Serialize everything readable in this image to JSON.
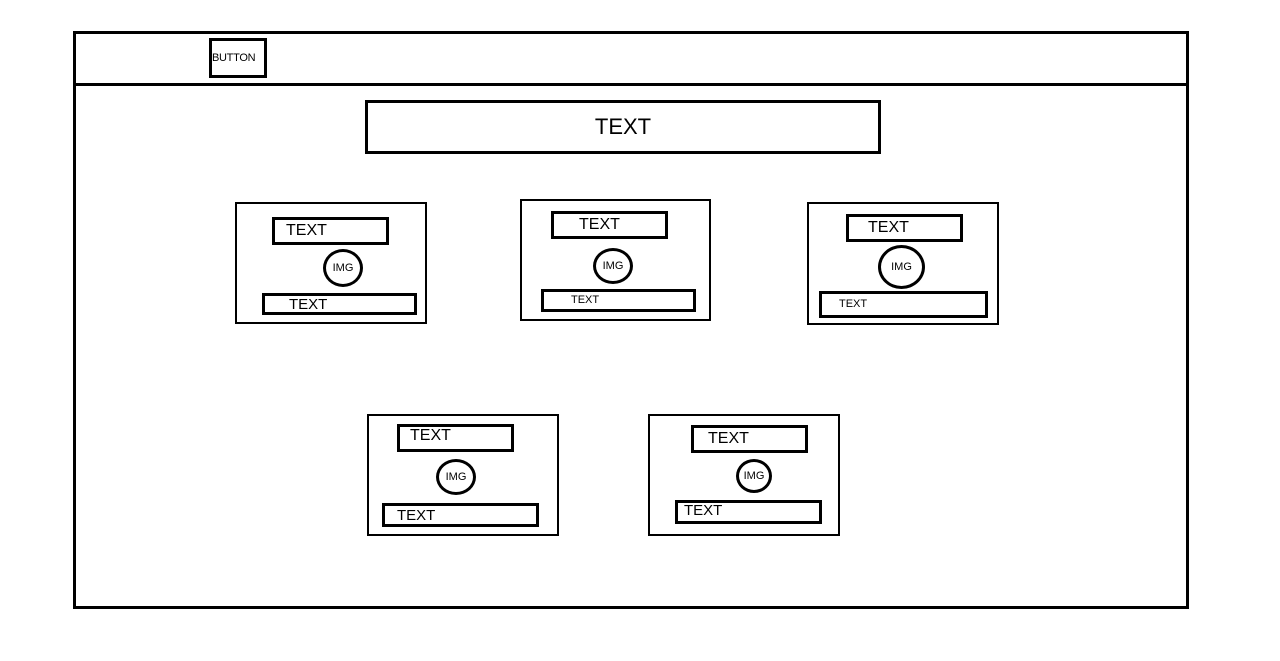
{
  "header": {
    "button_label": "BUTTON"
  },
  "main": {
    "title": "TEXT",
    "cards": [
      {
        "title": "TEXT",
        "image_label": "IMG",
        "caption": "TEXT"
      },
      {
        "title": "TEXT",
        "image_label": "IMG",
        "caption": "TEXT"
      },
      {
        "title": "TEXT",
        "image_label": "IMG",
        "caption": "TEXT"
      },
      {
        "title": "TEXT",
        "image_label": "IMG",
        "caption": "TEXT"
      },
      {
        "title": "TEXT",
        "image_label": "IMG",
        "caption": "TEXT"
      }
    ]
  },
  "colors": {
    "stroke": "#000000",
    "background": "#ffffff"
  }
}
